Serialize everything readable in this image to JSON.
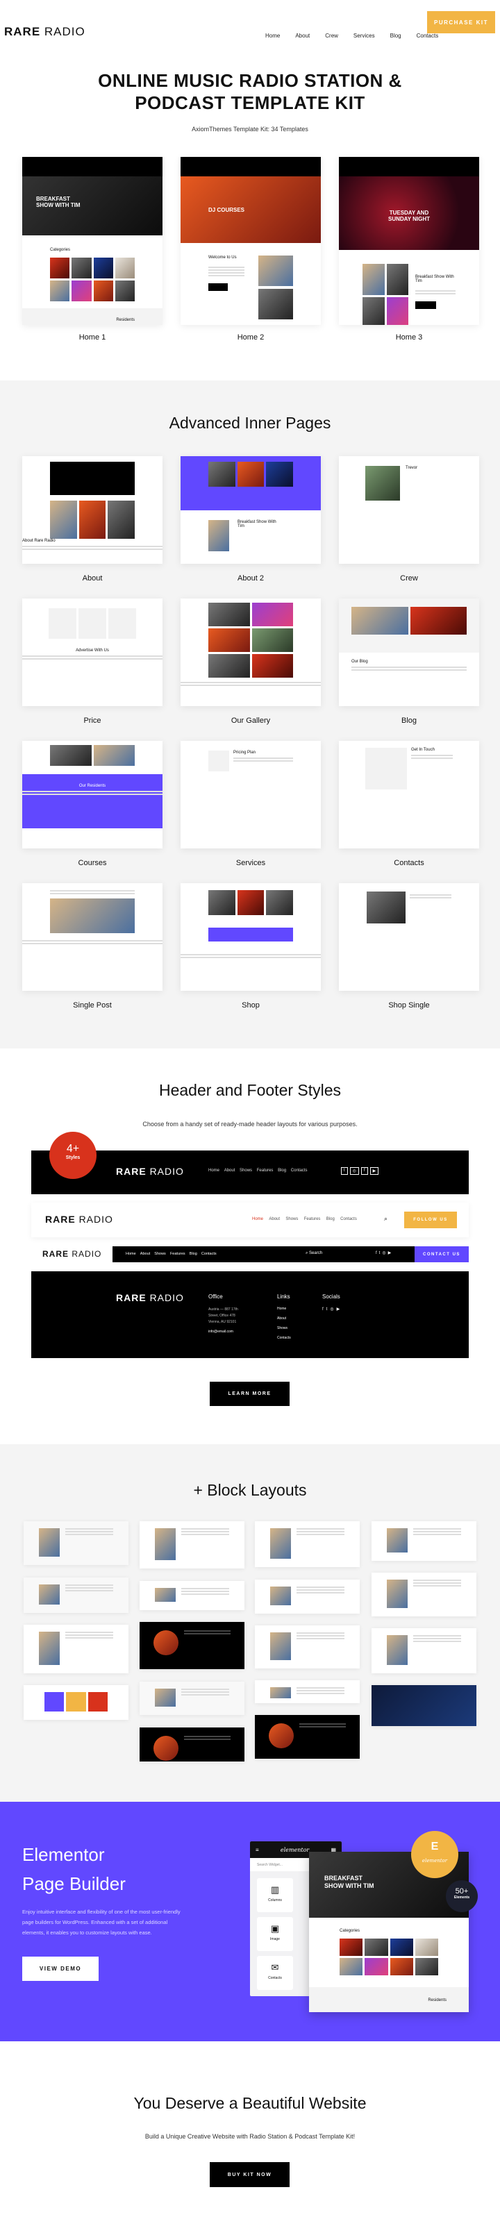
{
  "header": {
    "logo_bold": "RARE",
    "logo_light": "RADIO",
    "nav": [
      "Home",
      "About",
      "Crew",
      "Services",
      "Blog",
      "Contacts"
    ],
    "cta": "PURCHASE KIT",
    "cta_color": "#f2b544"
  },
  "hero": {
    "title_line1": "ONLINE MUSIC RADIO STATION &",
    "title_line2": "PODCAST TEMPLATE KIT",
    "subtitle": "AxiomThemes Template Kit: 34 Templates"
  },
  "homes": [
    {
      "label": "Home 1",
      "hero_text": "BREAKFAST SHOW WITH TIM",
      "section": "Categories",
      "section2": "Residents"
    },
    {
      "label": "Home 2",
      "hero_text": "DJ COURSES",
      "section": "Welcome to Us"
    },
    {
      "label": "Home 3",
      "hero_text": "TUESDAY AND SUNDAY NIGHT",
      "section": "Breakfast Show With Tim"
    }
  ],
  "inner": {
    "title": "Advanced Inner Pages",
    "pages": [
      {
        "label": "About",
        "text": "About Rare Radio"
      },
      {
        "label": "About 2",
        "text": "Breakfast Show With Tim"
      },
      {
        "label": "Crew",
        "text": "Trevor"
      },
      {
        "label": "Price",
        "text": "Advertise With Us"
      },
      {
        "label": "Our Gallery",
        "text": ""
      },
      {
        "label": "Blog",
        "text": "Our Blog"
      },
      {
        "label": "Courses",
        "text": "Our Residents"
      },
      {
        "label": "Services",
        "text": "Pricing Plan"
      },
      {
        "label": "Contacts",
        "text": "Get In Touch"
      },
      {
        "label": "Single Post",
        "text": ""
      },
      {
        "label": "Shop",
        "text": ""
      },
      {
        "label": "Shop Single",
        "text": ""
      }
    ]
  },
  "hf": {
    "title": "Header and Footer Styles",
    "subtitle": "Choose from a handy set of ready-made header layouts for various purposes.",
    "badge_num": "4+",
    "badge_text": "Styles",
    "badge_color": "#d8321c",
    "nav": [
      "Home",
      "About",
      "Shows",
      "Features",
      "Blog",
      "Contacts"
    ],
    "follow": "FOLLOW US",
    "search": "Search",
    "contact": "CONTACT US",
    "contact_color": "#6148ff",
    "footer": {
      "office_title": "Office",
      "address": [
        "Austria — 887 17th",
        "Street, Office 478",
        "Vienna, AU 92101"
      ],
      "email": "info@email.com",
      "links_title": "Links",
      "links": [
        "Home",
        "About",
        "Shows",
        "Contacts"
      ],
      "socials_title": "Socials"
    },
    "learn_more": "LEARN MORE"
  },
  "blocks": {
    "title": "+ Block Layouts"
  },
  "elementor": {
    "title_line1": "Elementor",
    "title_line2": "Page Builder",
    "desc": "Enjoy intuitive interface and flexibility of one of the most user-friendly page builders for WordPress. Enhanced with a set of additional elements, it enables you to customize layouts with ease.",
    "button": "VIEW DEMO",
    "bg_color": "#6148ff",
    "panel": {
      "brand": "elementor",
      "search_placeholder": "Search Widget...",
      "widgets": [
        "Columns",
        "Image",
        "Contacts"
      ]
    },
    "preview": {
      "hero": "BREAKFAST SHOW WITH TIM",
      "section": "Categories",
      "section2": "Residents"
    },
    "badge_logo": "elementor",
    "badge2_num": "50+",
    "badge2_text": "Elements"
  },
  "final": {
    "title": "You Deserve a Beautiful Website",
    "subtitle": "Build a Unique Creative Website with Radio Station & Podcast Template Kit!",
    "button": "BUY KIT NOW"
  }
}
